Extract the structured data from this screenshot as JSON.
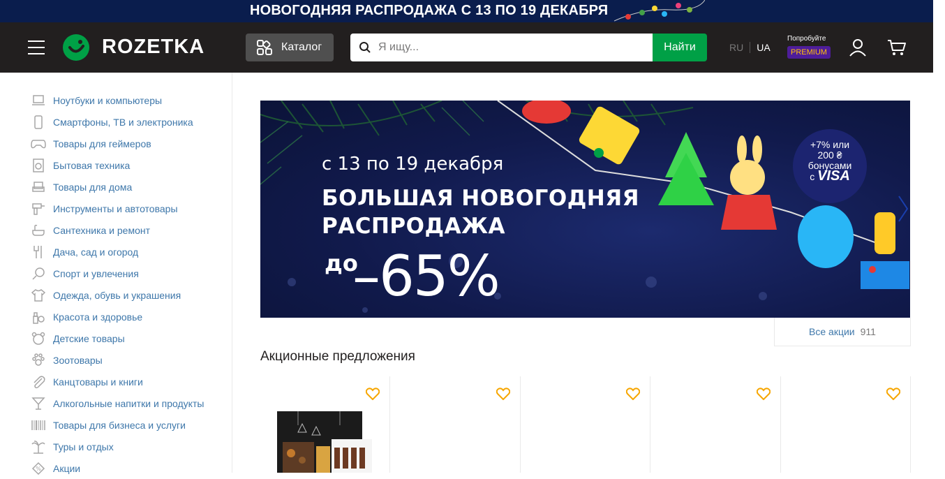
{
  "promo_strip": {
    "text": "НОВОГОДНЯЯ РАСПРОДАЖА С 13 ПО 19 ДЕКАБРЯ"
  },
  "header": {
    "logo_text": "ROZETKA",
    "catalog_label": "Каталог",
    "search_placeholder": "Я ищу...",
    "search_button": "Найти",
    "lang_ru": "RU",
    "lang_ua": "UA",
    "premium_try": "Попробуйте",
    "premium_badge": "PREMIUM"
  },
  "sidebar": {
    "items": [
      {
        "label": "Ноутбуки и компьютеры",
        "icon": "laptop-icon"
      },
      {
        "label": "Смартфоны, ТВ и электроника",
        "icon": "smartphone-icon"
      },
      {
        "label": "Товары для геймеров",
        "icon": "gamepad-icon"
      },
      {
        "label": "Бытовая техника",
        "icon": "washing-machine-icon"
      },
      {
        "label": "Товары для дома",
        "icon": "armchair-icon"
      },
      {
        "label": "Инструменты и автотовары",
        "icon": "drill-icon"
      },
      {
        "label": "Сантехника и ремонт",
        "icon": "bathtub-icon"
      },
      {
        "label": "Дача, сад и огород",
        "icon": "garden-fork-icon"
      },
      {
        "label": "Спорт и увлечения",
        "icon": "racket-icon"
      },
      {
        "label": "Одежда, обувь и украшения",
        "icon": "tshirt-icon"
      },
      {
        "label": "Красота и здоровье",
        "icon": "cosmetics-icon"
      },
      {
        "label": "Детские товары",
        "icon": "teddy-bear-icon"
      },
      {
        "label": "Зоотовары",
        "icon": "paw-icon"
      },
      {
        "label": "Канцтовары и книги",
        "icon": "paperclip-icon"
      },
      {
        "label": "Алкогольные напитки и продукты",
        "icon": "cocktail-icon"
      },
      {
        "label": "Товары для бизнеса и услуги",
        "icon": "barcode-icon"
      },
      {
        "label": "Туры и отдых",
        "icon": "palm-tree-icon"
      },
      {
        "label": "Акции",
        "icon": "percent-tag-icon"
      }
    ]
  },
  "banner": {
    "dates": "с 13 по 19 декабря",
    "headline_line1": "БОЛЬШАЯ НОВОГОДНЯЯ",
    "headline_line2": "РАСПРОДАЖА",
    "upto": "до",
    "discount": "–65%",
    "visa_line1": "+7% или",
    "visa_line2": "200 ₴",
    "visa_line3": "бонусами",
    "visa_line4_prefix": "с",
    "visa_brand": "VISA"
  },
  "all_promos": {
    "label": "Все акции",
    "count": "911"
  },
  "section_title": "Акционные предложения",
  "colors": {
    "header_bg": "#221f1f",
    "promo_bg": "#0a1d4d",
    "accent_green": "#00a046",
    "link_blue": "#3e77aa",
    "heart_orange": "#f7a600",
    "premium_purple": "#4e1d9a"
  }
}
